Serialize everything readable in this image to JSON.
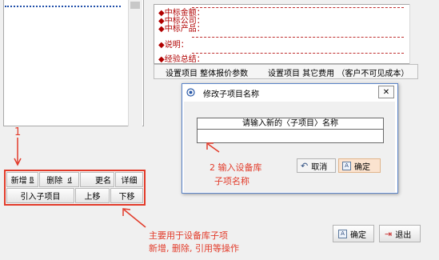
{
  "left_buttons": {
    "add": "新增",
    "add_key": "B",
    "delete": "删除",
    "delete_key": "d",
    "rename": "更名",
    "detail": "详细",
    "import_child": "引入子项目",
    "move_up": "上移",
    "move_down": "下移"
  },
  "editor": {
    "lines": [
      "◆中标金额：",
      "◆中标公司：",
      "◆中标产品：",
      "◆说明：",
      "◆经验总结："
    ]
  },
  "tabs": [
    "设置项目 整体报价参数",
    "设置项目 其它费用 （客户不可见成本）"
  ],
  "dialog": {
    "title": "修改子项目名称",
    "prompt": "请输入新的〈子项目〉名称",
    "value": "",
    "cancel": "取消",
    "ok": "确定"
  },
  "bottom": {
    "ok": "确定",
    "exit": "退出"
  },
  "annotations": {
    "marker_1": "1",
    "note_2_line1": "2  输入设备库",
    "note_2_line2": "子项名称",
    "note_main_line1": "主要用于设备库子项",
    "note_main_line2": "新增, 删除, 引用等操作"
  },
  "colors": {
    "annotation": "#e23b2a",
    "field_text": "#b00000",
    "dialog_border": "#5b84c8"
  },
  "icons": {
    "dialog": "circle-dot-icon",
    "cancel": "undo-icon",
    "ok": "confirm-icon",
    "exit": "exit-icon"
  }
}
